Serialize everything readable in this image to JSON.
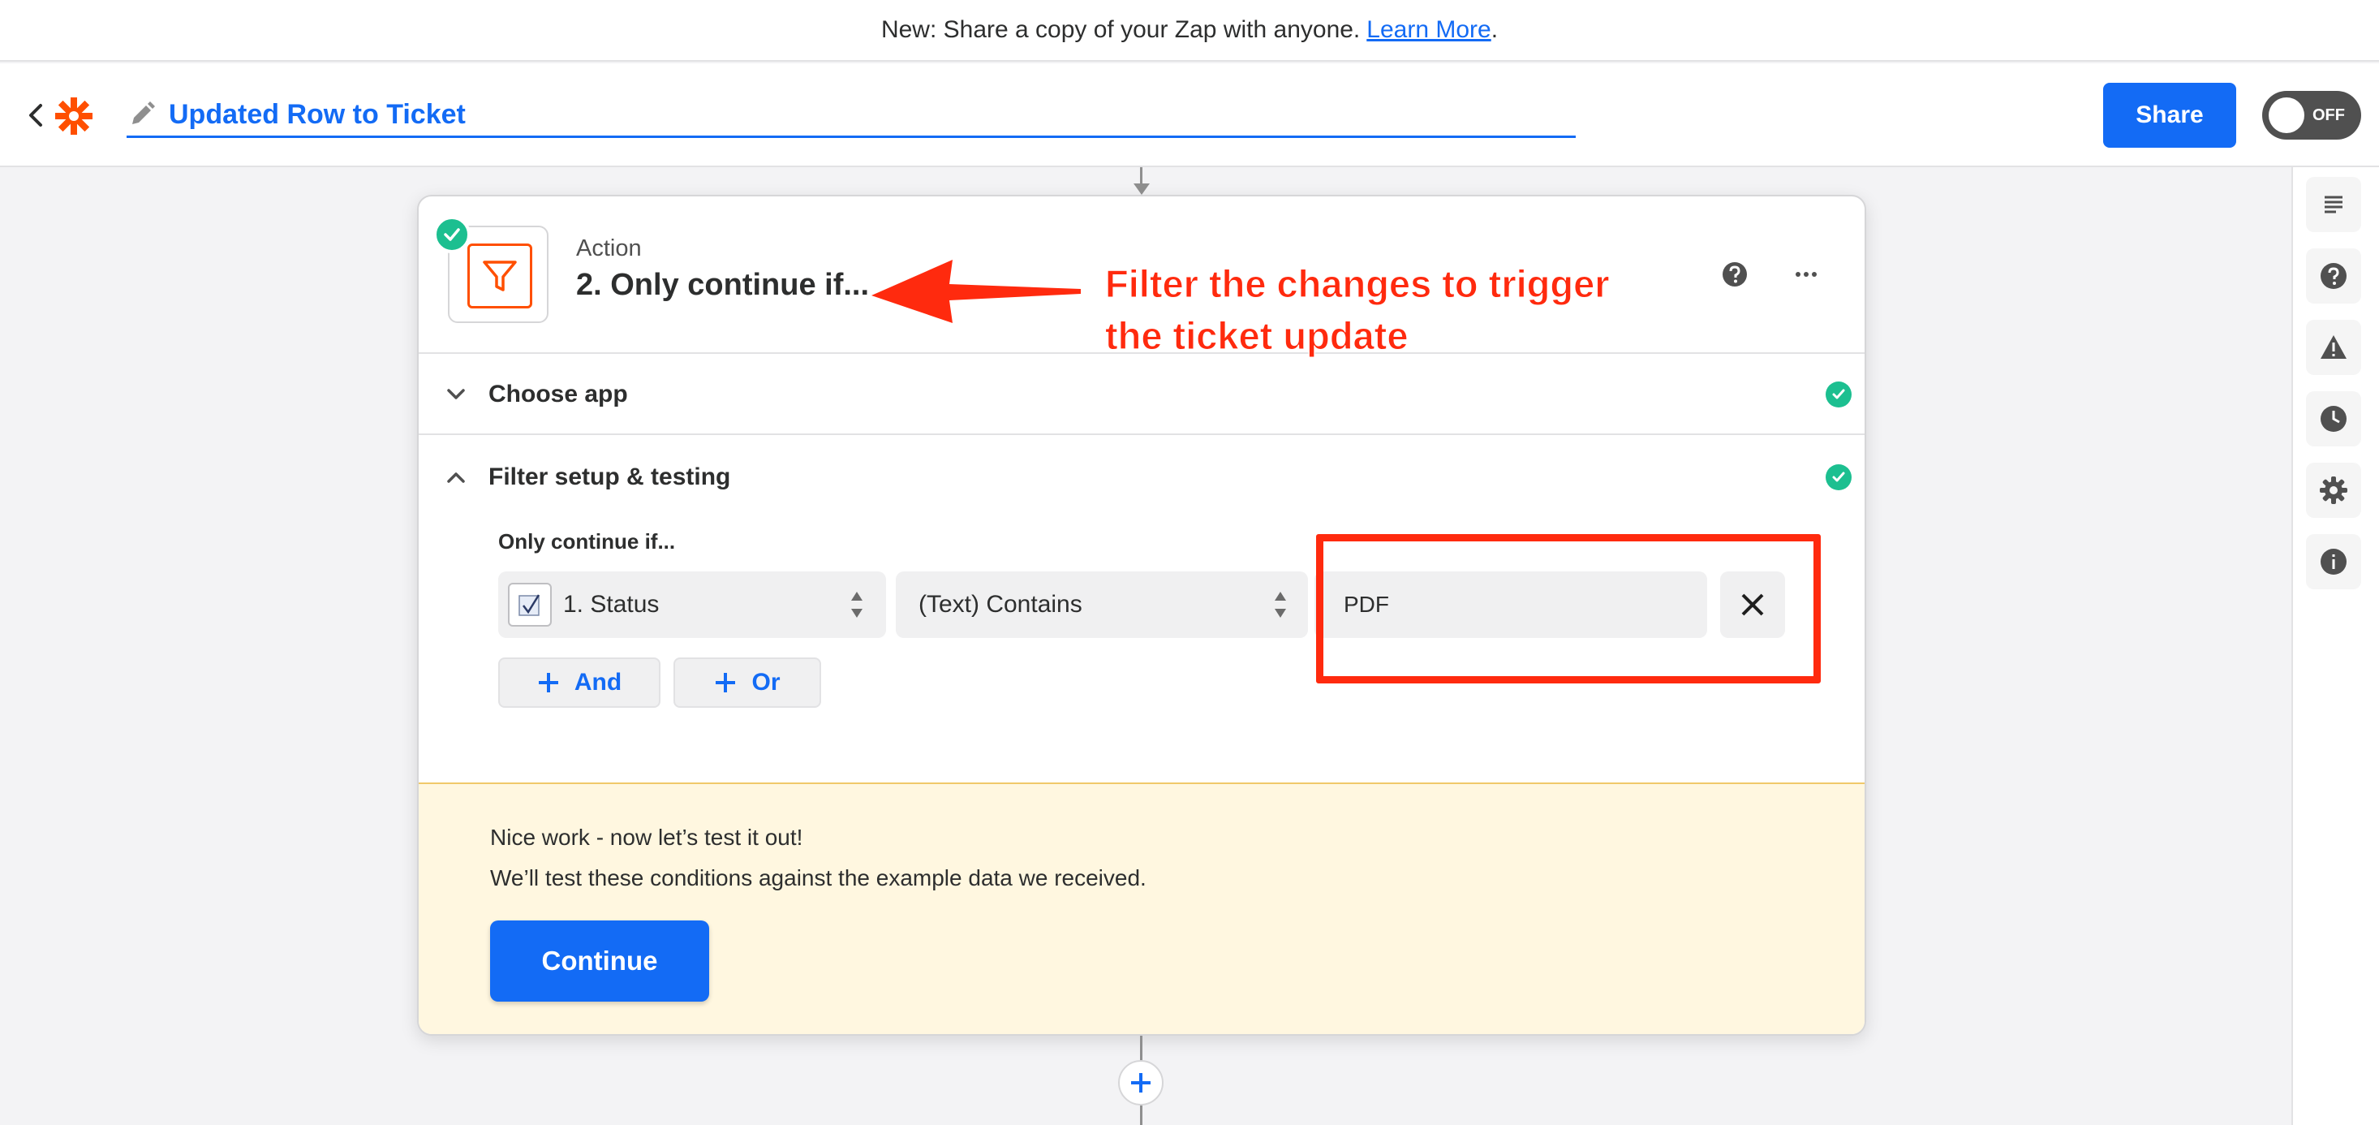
{
  "banner": {
    "text": "New: Share a copy of your Zap with anyone.",
    "link": "Learn More",
    "suffix": "."
  },
  "header": {
    "zap_title": "Updated Row to Ticket",
    "share_label": "Share",
    "toggle_label": "OFF"
  },
  "step": {
    "type": "Action",
    "name": "2. Only continue if..."
  },
  "sections": {
    "choose_app": "Choose app",
    "filter_setup": "Filter setup & testing"
  },
  "filter": {
    "only_label": "Only continue if...",
    "field": "1. Status",
    "condition": "(Text) Contains",
    "value": "PDF",
    "and_label": "And",
    "or_label": "Or"
  },
  "test": {
    "line1": "Nice work - now let’s test it out!",
    "line2": "We’ll test these conditions against the example data we received.",
    "continue_label": "Continue"
  },
  "annotation": {
    "line1": "Filter the changes to trigger",
    "line2": "the ticket update"
  },
  "colors": {
    "accent": "#136bf5",
    "zapier_orange": "#ff4f00",
    "success": "#1cbf90",
    "annotation_red": "#ff2a0e",
    "test_panel_bg": "#fff7e0"
  },
  "icons": {
    "rail": [
      "outline-icon",
      "help-icon",
      "warning-icon",
      "history-icon",
      "settings-icon",
      "info-icon"
    ]
  }
}
